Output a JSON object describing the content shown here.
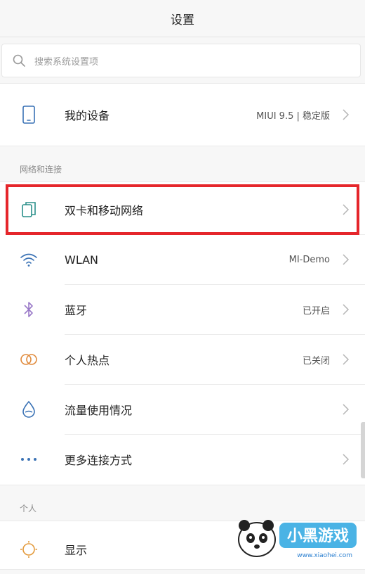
{
  "header": {
    "title": "设置"
  },
  "search": {
    "placeholder": "搜索系统设置项",
    "icon": "search-icon"
  },
  "device": {
    "label": "我的设备",
    "value": "MIUI 9.5 | 稳定版",
    "icon": "phone-icon"
  },
  "network_section": {
    "title": "网络和连接",
    "items": [
      {
        "label": "双卡和移动网络",
        "value": "",
        "icon": "sim-cards-icon"
      },
      {
        "label": "WLAN",
        "value": "MI-Demo",
        "icon": "wifi-icon"
      },
      {
        "label": "蓝牙",
        "value": "已开启",
        "icon": "bluetooth-icon"
      },
      {
        "label": "个人热点",
        "value": "已关闭",
        "icon": "hotspot-icon"
      },
      {
        "label": "流量使用情况",
        "value": "",
        "icon": "data-usage-icon"
      },
      {
        "label": "更多连接方式",
        "value": "",
        "icon": "more-dots-icon"
      }
    ]
  },
  "personal_section": {
    "title": "个人",
    "items": [
      {
        "label": "显示",
        "value": "",
        "icon": "display-sun-icon"
      }
    ]
  },
  "watermark": {
    "text": "小黑游戏",
    "url_text": "www.xiaohei.com"
  },
  "colors": {
    "highlight": "#e5262b",
    "accent_teal": "#2a8f8a",
    "accent_blue": "#3a72b5",
    "bluetooth": "#9a7ac8",
    "hotspot": "#e08a3c",
    "display": "#e39a3c"
  }
}
